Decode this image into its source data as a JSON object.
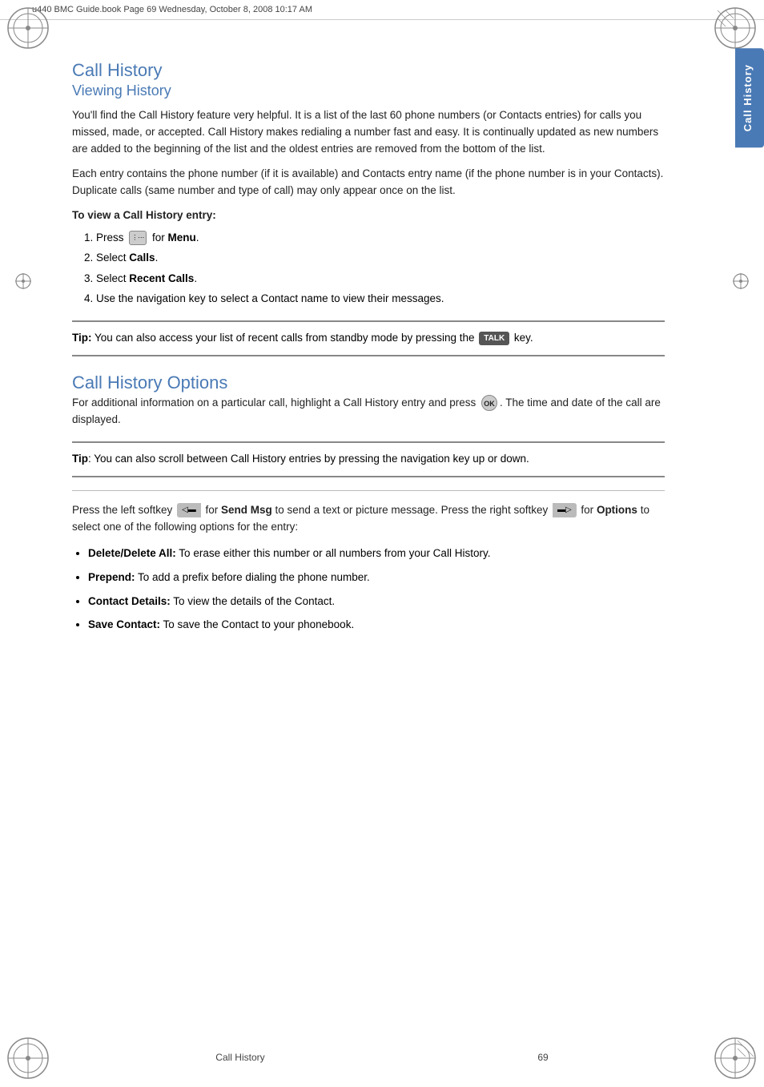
{
  "header": {
    "text": "u440 BMC Guide.book  Page 69  Wednesday, October 8, 2008  10:17 AM"
  },
  "side_tab": {
    "label": "Call History"
  },
  "main": {
    "h1": "Call History",
    "h2": "Viewing History",
    "viewing_para1": "You'll find the Call History feature very helpful. It is a list of the last 60 phone numbers (or Contacts entries) for calls you missed, made, or accepted. Call History makes redialing a number fast and easy. It is continually updated as new numbers are added to the beginning of the list and the oldest entries are removed from the bottom of the list.",
    "viewing_para2": "Each entry contains the phone number (if it is available) and Contacts entry name (if the phone number is in your Contacts). Duplicate calls (same number and type of call) may only appear once on the list.",
    "steps_heading": "To view a Call History entry:",
    "steps": [
      "Press  for Menu.",
      "Select Calls.",
      "Select Recent Calls.",
      "Use the navigation key to select a Contact name to view their messages."
    ],
    "tip1_label": "Tip:",
    "tip1_text": " You can also access your list of recent calls from standby mode by pressing the  key.",
    "h1_options": "Call History Options",
    "options_para1": "For additional information on a particular call, highlight a Call History entry and press  . The time and date of the call are displayed.",
    "tip2_label": "Tip",
    "tip2_text": ": You can also scroll between Call History entries by pressing the navigation key up or down.",
    "softkey_para": "Press the left softkey  for Send Msg to send a text or picture message. Press the right softkey  for Options to select one of the following options for the entry:",
    "options_list": [
      {
        "bold": "Delete/Delete All:",
        "text": " To erase either this number or all numbers from your Call History."
      },
      {
        "bold": "Prepend:",
        "text": " To add a prefix before dialing the phone number."
      },
      {
        "bold": "Contact Details:",
        "text": " To view the details of the Contact."
      },
      {
        "bold": "Save Contact:",
        "text": " To save the Contact to your phonebook."
      }
    ]
  },
  "footer": {
    "label": "Call History",
    "page": "69"
  }
}
